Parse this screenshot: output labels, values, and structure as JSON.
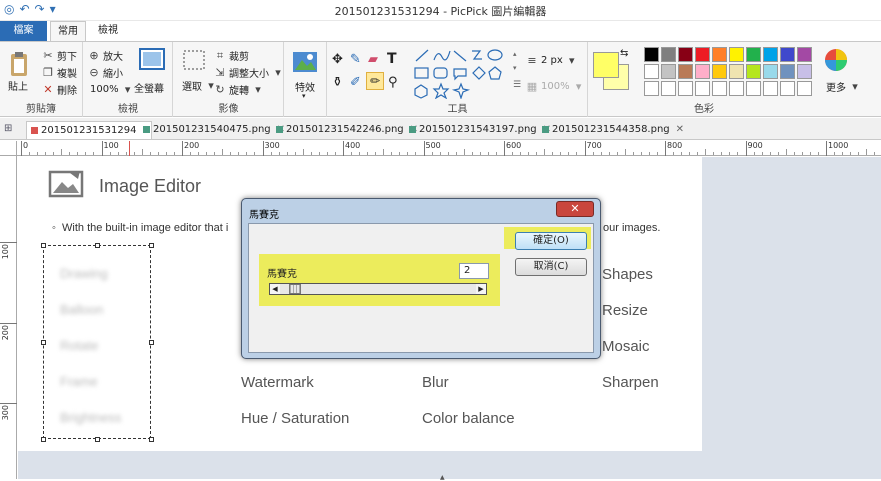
{
  "window": {
    "title": "201501231531294 - PicPick 圖片編輯器"
  },
  "qat": [
    "◎",
    "↶",
    "↷",
    "▾"
  ],
  "tabs": {
    "file": "檔案",
    "home": "常用",
    "view": "檢視"
  },
  "ribbon": {
    "clipboard": {
      "label": "剪貼簿",
      "paste": "貼上",
      "cut": "剪下",
      "copy": "複製",
      "delete": "刪除"
    },
    "view": {
      "label": "檢視",
      "zoom_in": "放大",
      "zoom_out": "縮小",
      "zoom": "100%",
      "fullscreen": "全螢幕"
    },
    "image": {
      "label": "影像",
      "select": "選取",
      "crop": "裁剪",
      "resize": "調整大小",
      "rotate": "旋轉"
    },
    "effects": {
      "label": "特效"
    },
    "tools": {
      "label": "工具",
      "line_width": "2 px",
      "opacity": "100%"
    },
    "colors": {
      "label": "色彩",
      "more": "更多",
      "primary": "#ffff66",
      "secondary": "#ffffaa"
    }
  },
  "palette": [
    "#000000",
    "#7f7f7f",
    "#880015",
    "#ed1c24",
    "#ff7f27",
    "#fff200",
    "#22b14c",
    "#00a2e8",
    "#3f48cc",
    "#a349a4",
    "#ffffff",
    "#c3c3c3",
    "#b97a57",
    "#ffaec9",
    "#ffc90e",
    "#efe4b0",
    "#b5e61d",
    "#99d9ea",
    "#7092be",
    "#c8bfe7",
    "#ffffff",
    "#ffffff",
    "#ffffff",
    "#ffffff",
    "#ffffff",
    "#ffffff",
    "#ffffff",
    "#ffffff",
    "#ffffff",
    "#ffffff"
  ],
  "doc_tabs": [
    {
      "name": "201501231531294",
      "color": "#d9534f"
    },
    {
      "name": "201501231540475.png",
      "color": "#4a9b82"
    },
    {
      "name": "201501231542246.png",
      "color": "#4a9b82"
    },
    {
      "name": "201501231543197.png",
      "color": "#4a9b82"
    },
    {
      "name": "201501231544358.png",
      "color": "#4a9b82"
    }
  ],
  "ruler_h": [
    "0",
    "100",
    "200",
    "300",
    "400",
    "500",
    "600",
    "700",
    "800",
    "900",
    "1000"
  ],
  "ruler_v": [
    "100",
    "200",
    "300"
  ],
  "canvas": {
    "title": "Image Editor",
    "bullet": "With the built-in image editor that i",
    "bullet_tail": "our images.",
    "blurred": [
      "Drawing",
      "Balloon",
      "Rotate",
      "Frame",
      "Brightness"
    ],
    "col3": [
      "Shapes",
      "Resize",
      "Mosaic",
      "Sharpen"
    ],
    "row4": [
      "Watermark",
      "Blur"
    ],
    "row5": [
      "Hue / Saturation",
      "Color balance"
    ]
  },
  "dialog": {
    "title": "馬賽克",
    "close": "✕",
    "field_label": "馬賽克",
    "value": "2",
    "ok": "確定(O)",
    "cancel": "取消(C)",
    "slider_level": 0.05
  }
}
